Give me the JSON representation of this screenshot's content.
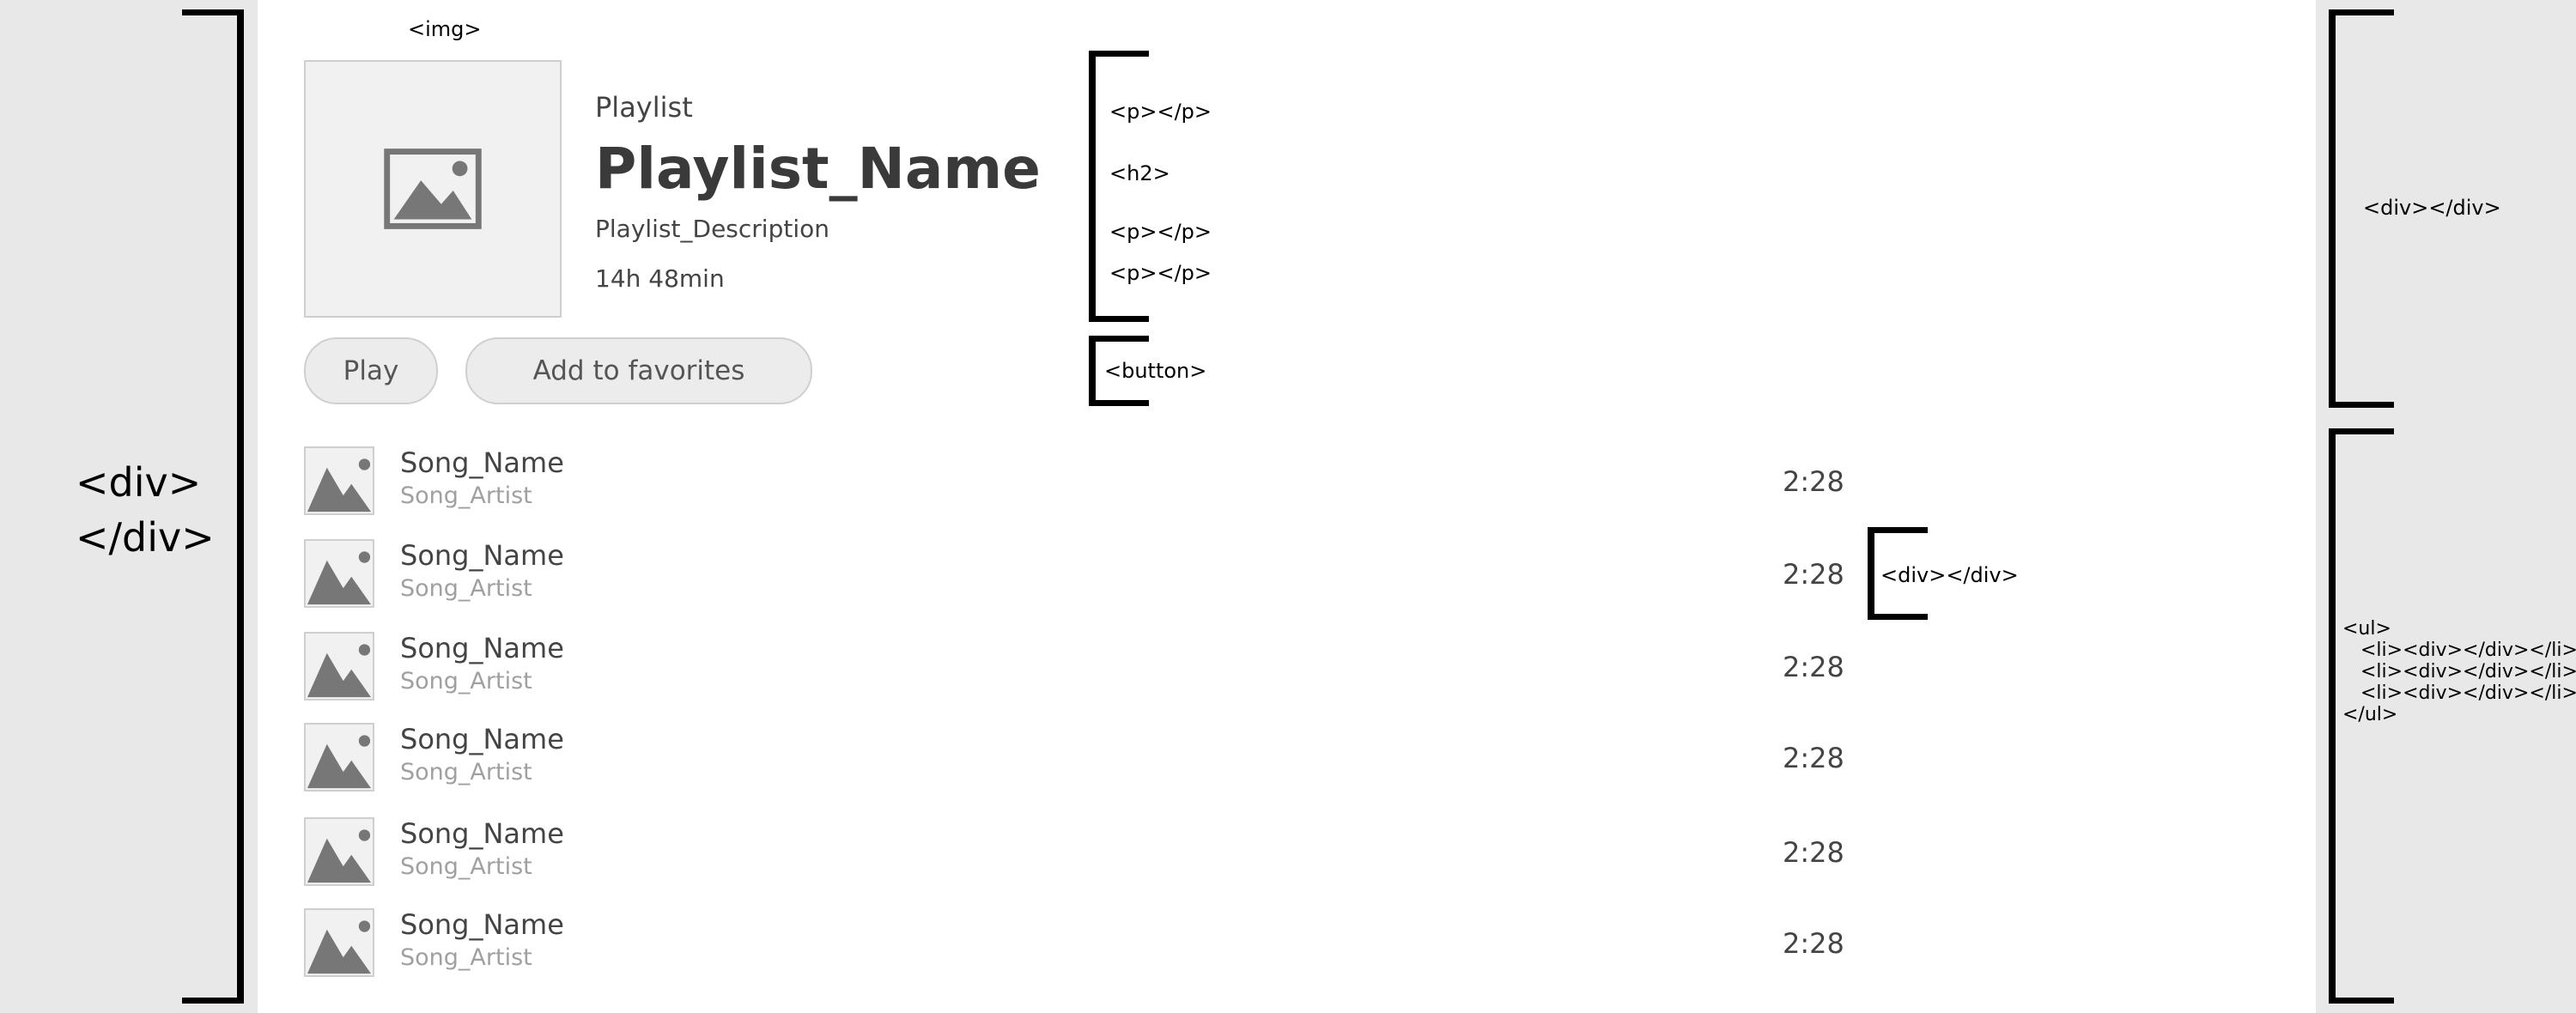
{
  "annotations": {
    "outer_div": "<div>\n</div>",
    "img": "<img>",
    "p": "<p></p>",
    "h2": "<h2>",
    "button": "<button>",
    "header_div": "<div></div>",
    "song_div": "<div></div>",
    "ul": "<ul>\n   <li><div></div></li>\n   <li><div></div></li>\n   <li><div></div></li>\n</ul>"
  },
  "playlist": {
    "label": "Playlist",
    "name": "Playlist_Name",
    "description": "Playlist_Description",
    "duration": "14h 48min",
    "cover_icon": "image-placeholder-icon"
  },
  "buttons": {
    "play": "Play",
    "favorite": "Add to favorites"
  },
  "songs": [
    {
      "name": "Song_Name",
      "artist": "Song_Artist",
      "duration": "2:28"
    },
    {
      "name": "Song_Name",
      "artist": "Song_Artist",
      "duration": "2:28"
    },
    {
      "name": "Song_Name",
      "artist": "Song_Artist",
      "duration": "2:28"
    },
    {
      "name": "Song_Name",
      "artist": "Song_Artist",
      "duration": "2:28"
    },
    {
      "name": "Song_Name",
      "artist": "Song_Artist",
      "duration": "2:28"
    },
    {
      "name": "Song_Name",
      "artist": "Song_Artist",
      "duration": "2:28"
    }
  ],
  "colors": {
    "page_background": "#e8e8e8",
    "panel_background": "#ffffff",
    "button_fill": "#ececec",
    "placeholder_fill": "#f1f1f1",
    "placeholder_glyph": "#777777",
    "artist_text": "#a0a0a0"
  }
}
